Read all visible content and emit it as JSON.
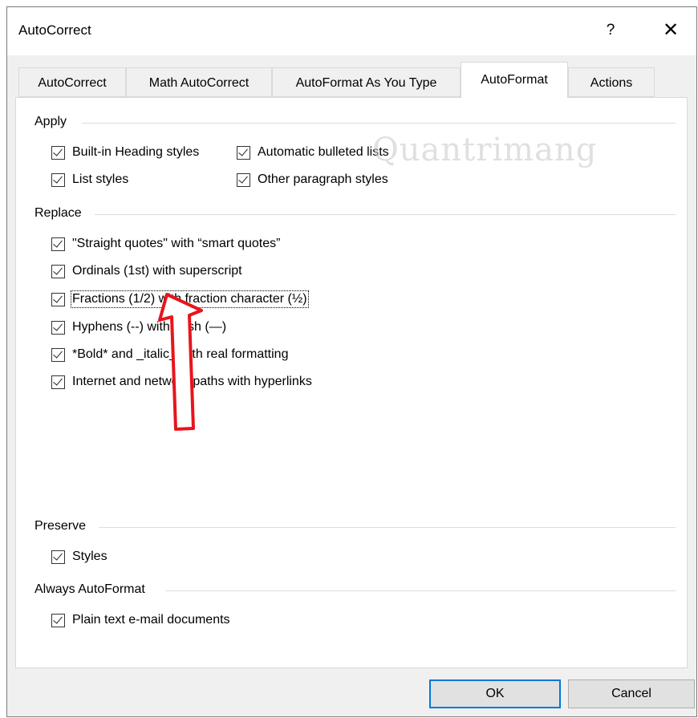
{
  "window": {
    "title": "AutoCorrect",
    "help": "?",
    "close": "✕"
  },
  "tabs": [
    {
      "label": "AutoCorrect",
      "active": false
    },
    {
      "label": "Math AutoCorrect",
      "active": false
    },
    {
      "label": "AutoFormat As You Type",
      "active": false
    },
    {
      "label": "AutoFormat",
      "active": true
    },
    {
      "label": "Actions",
      "active": false
    }
  ],
  "sections": {
    "apply": {
      "label": "Apply",
      "options": [
        {
          "label": "Built-in Heading styles",
          "checked": true
        },
        {
          "label": "Automatic bulleted lists",
          "checked": true
        },
        {
          "label": "List styles",
          "checked": true
        },
        {
          "label": "Other paragraph styles",
          "checked": true
        }
      ]
    },
    "replace": {
      "label": "Replace",
      "options": [
        {
          "label": "\"Straight quotes\" with “smart quotes”",
          "checked": true
        },
        {
          "label": "Ordinals (1st) with superscript",
          "checked": true
        },
        {
          "label": "Fractions (1/2) with fraction character (½)",
          "checked": true
        },
        {
          "label": "Hyphens (--) with dash (—)",
          "checked": true
        },
        {
          "label": "*Bold* and _italic_ with real formatting",
          "checked": true
        },
        {
          "label": "Internet and network paths with hyperlinks",
          "checked": true
        }
      ]
    },
    "preserve": {
      "label": "Preserve",
      "options": [
        {
          "label": "Styles",
          "checked": true
        }
      ]
    },
    "always": {
      "label": "Always AutoFormat",
      "options": [
        {
          "label": "Plain text e-mail documents",
          "checked": true
        }
      ]
    }
  },
  "buttons": {
    "ok": "OK",
    "cancel": "Cancel"
  },
  "watermark": "Quantrimang",
  "colors": {
    "accent": "#0078d7",
    "arrow": "#e8141c",
    "dialog_bg": "#f0f0f0"
  }
}
